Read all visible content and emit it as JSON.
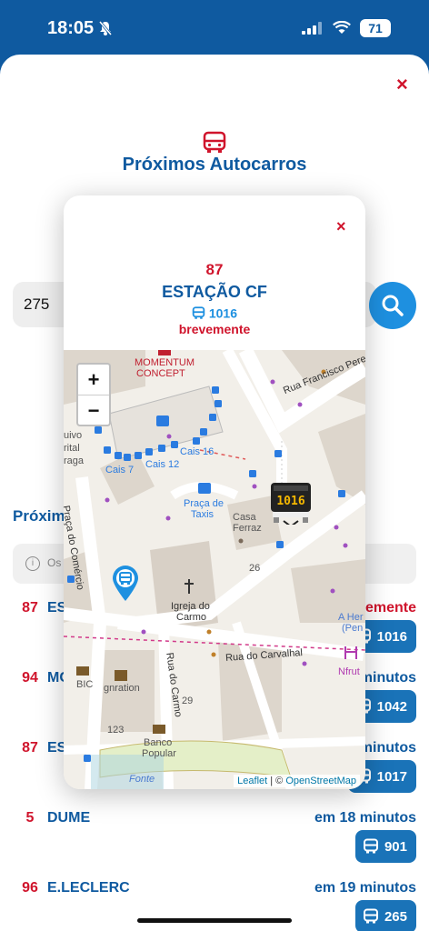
{
  "status": {
    "time": "18:05",
    "battery": "71"
  },
  "sheet": {
    "title": "Próximos Autocarros",
    "close_label": "×"
  },
  "search": {
    "value": "275"
  },
  "section": {
    "title": "Próxim",
    "info_text": "Os h"
  },
  "arrivals": [
    {
      "route": "87",
      "dest": "ES",
      "eta": "brevemente",
      "vehicle": "1016"
    },
    {
      "route": "94",
      "dest": "MC",
      "eta": "minutos",
      "vehicle": "1042"
    },
    {
      "route": "87",
      "dest": "ES",
      "eta": "minutos",
      "vehicle": "1017"
    },
    {
      "route": "5",
      "dest": "DUME",
      "eta": "em 18 minutos",
      "vehicle": "901"
    },
    {
      "route": "96",
      "dest": "E.LECLERC",
      "eta": "em 19 minutos",
      "vehicle": "265"
    }
  ],
  "modal": {
    "close_label": "×",
    "route": "87",
    "stop_name": "ESTAÇÃO CF",
    "vehicle": "1016",
    "eta": "brevemente",
    "bus_marker_label": "1016"
  },
  "map": {
    "zoom_in": "+",
    "zoom_out": "−",
    "attribution_leaflet": "Leaflet",
    "attribution_sep": " | © ",
    "attribution_osm": "OpenStreetMap",
    "labels": {
      "momentum": "MOMENTUM",
      "concept": "CONCEPT",
      "rua_francisco": "Rua Francisco Pere",
      "cais16": "Cais 16",
      "cais12": "Cais 12",
      "cais7": "Cais 7",
      "praca_de": "Praça de",
      "taxis": "Taxis",
      "casa": "Casa",
      "ferraz": "Ferraz",
      "n26": "26",
      "praca_comercio": "Praça do Comércio",
      "igreja": "Igreja do",
      "carmo": "Carmo",
      "rua_carvalhal": "Rua do Carvalhal",
      "a_her": "A Her",
      "pen": "(Pen",
      "nfrut": "Nfrut",
      "bic": "BIC",
      "gnration": "gnration",
      "rua_carmo": "Rua do Carmo",
      "n29": "29",
      "n123": "123",
      "banco": "Banco",
      "popular": "Popular",
      "fonte": "Fonte",
      "uivo": "uivo",
      "rital": "rital",
      "raga": "raga"
    }
  },
  "colors": {
    "brand_blue": "#0f5aa0",
    "accent_red": "#d0142c",
    "button_blue": "#1e90e0",
    "badge_blue": "#1a73b8"
  }
}
